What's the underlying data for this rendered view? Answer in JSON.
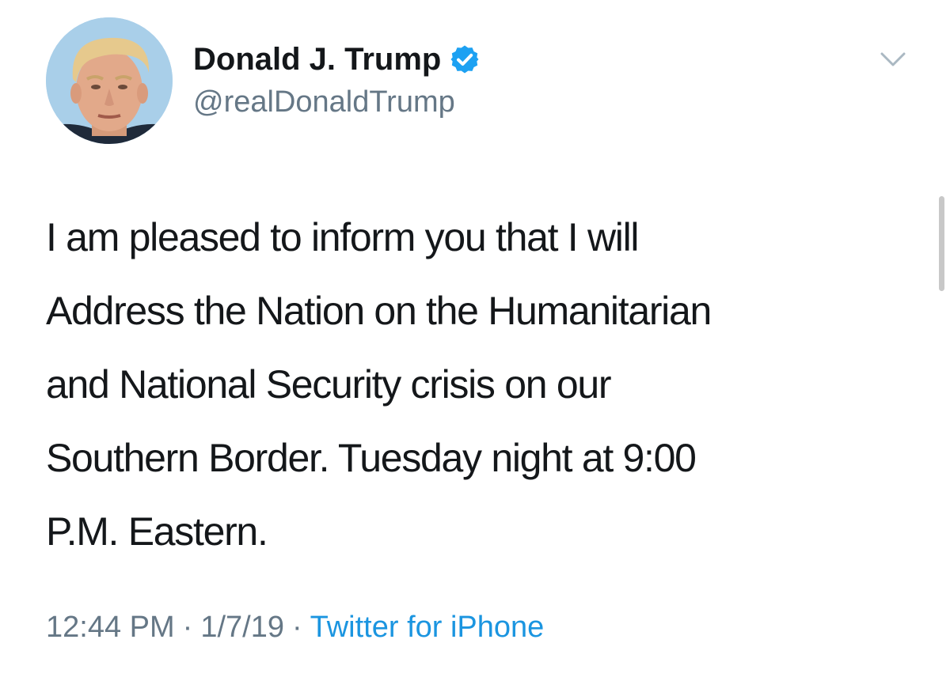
{
  "tweet": {
    "author": {
      "display_name": "Donald J. Trump",
      "handle": "@realDonaldTrump",
      "verified": true,
      "avatar_icon": "profile-photo"
    },
    "text_lines": [
      "I am pleased to inform you that I will",
      "Address the Nation on the Humanitarian",
      "and National Security crisis on our",
      "Southern Border. Tuesday night at 9:00",
      "P.M. Eastern."
    ],
    "meta": {
      "time": "12:44 PM",
      "separator": "·",
      "date": "1/7/19",
      "source": "Twitter for iPhone"
    },
    "menu_icon": "chevron-down-icon"
  },
  "colors": {
    "text_primary": "#14171a",
    "text_secondary": "#657786",
    "link": "#1b95e0",
    "verified_badge": "#1da1f2",
    "avatar_background": "#a9cfe9"
  }
}
